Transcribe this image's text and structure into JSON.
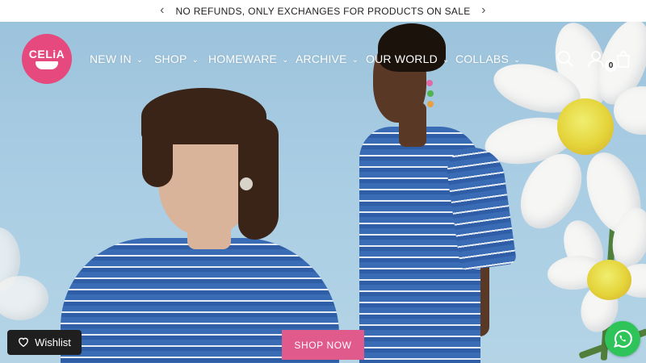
{
  "announcement": {
    "text": "NO REFUNDS, ONLY EXCHANGES FOR PRODUCTS ON SALE",
    "prev_icon": "chevron-left-icon",
    "next_icon": "chevron-right-icon"
  },
  "brand": {
    "logo_text": "CELiA",
    "color": "#e5497e"
  },
  "nav": {
    "items": [
      {
        "label": "NEW IN"
      },
      {
        "label": "SHOP"
      },
      {
        "label": "HOMEWARE"
      },
      {
        "label": "ARCHIVE"
      },
      {
        "label": "OUR WORLD"
      },
      {
        "label": "COLLABS"
      }
    ],
    "dropdown_icon": "chevron-down-icon"
  },
  "header_icons": {
    "search": "search-icon",
    "account": "user-icon",
    "cart": "cart-icon",
    "cart_count": "0"
  },
  "hero": {
    "cta_label": "SHOP NOW",
    "cta_color": "#e05a8c"
  },
  "wishlist": {
    "label": "Wishlist",
    "icon": "heart-icon"
  },
  "chat": {
    "icon": "whatsapp-icon",
    "color": "#2ec45a"
  }
}
